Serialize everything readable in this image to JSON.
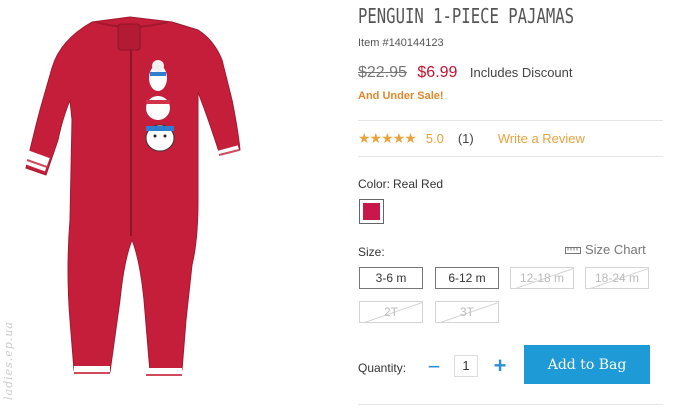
{
  "product": {
    "title": "PENGUIN 1-PIECE PAJAMAS",
    "item_number": "Item #140144123",
    "image_alt": "Penguin 1-piece pajamas in red"
  },
  "price": {
    "original": "$22.95",
    "sale": "$6.99",
    "note": "Includes Discount",
    "sale_note": "And Under Sale!"
  },
  "rating": {
    "stars": "★★★★★",
    "value": 5.0,
    "score_text": "5.0",
    "count_text": "(1)",
    "write_review": "Write a Review"
  },
  "color": {
    "label": "Color:",
    "selected": "Real Red",
    "swatch": "#c8174a"
  },
  "size": {
    "label": "Size:",
    "chart_label": "Size Chart",
    "chart_icon": "ruler-icon",
    "options": [
      {
        "label": "3-6 m",
        "available": true
      },
      {
        "label": "6-12 m",
        "available": true
      },
      {
        "label": "12-18 m",
        "available": false
      },
      {
        "label": "18-24 m",
        "available": false
      },
      {
        "label": "2T",
        "available": false
      },
      {
        "label": "3T",
        "available": false
      }
    ]
  },
  "quantity": {
    "label": "Quantity:",
    "value": "1",
    "minus": "−",
    "plus": "+"
  },
  "actions": {
    "add_to_bag": "Add to Bag"
  },
  "watermark": "ladies.ep.ua",
  "colors": {
    "sale_price": "#c8102e",
    "accent_orange": "#e8a33d",
    "button_blue": "#1e9ad6",
    "garment_red": "#c41e3a"
  }
}
